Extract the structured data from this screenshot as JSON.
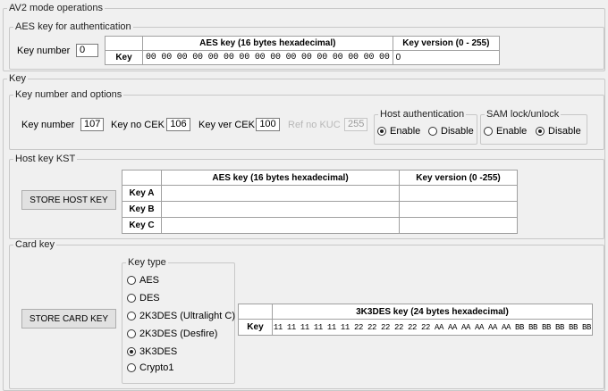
{
  "auth": {
    "group_title": "AV2 mode operations",
    "section_title": "AES key for authentication",
    "key_number_label": "Key number",
    "key_number_value": "0",
    "col_key": "AES key (16 bytes hexadecimal)",
    "col_version": "Key version (0 - 255)",
    "row_label": "Key",
    "key_value": "00 00 00 00 00 00 00 00 00 00 00 00 00 00 00 00",
    "version_value": "0"
  },
  "key": {
    "group_title": "Key",
    "options": {
      "title": "Key number and options",
      "key_number_label": "Key number",
      "key_number_value": "107",
      "key_no_cek_label": "Key no CEK",
      "key_no_cek_value": "106",
      "key_ver_cek_label": "Key ver CEK",
      "key_ver_cek_value": "100",
      "ref_no_kuc_label": "Ref no KUC",
      "ref_no_kuc_value": "255",
      "host_auth": {
        "title": "Host authentication",
        "enable_label": "Enable",
        "disable_label": "Disable",
        "selected": "Enable"
      },
      "sam_lock": {
        "title": "SAM lock/unlock",
        "enable_label": "Enable",
        "disable_label": "Disable",
        "selected": "Disable"
      }
    },
    "host_kst": {
      "title": "Host key KST",
      "store_button": "STORE HOST KEY",
      "col_key": "AES key (16 bytes hexadecimal)",
      "col_version": "Key version (0 -255)",
      "rows": [
        {
          "label": "Key A",
          "key": "",
          "version": ""
        },
        {
          "label": "Key B",
          "key": "",
          "version": ""
        },
        {
          "label": "Key C",
          "key": "",
          "version": ""
        }
      ]
    },
    "card_key": {
      "title": "Card key",
      "store_button": "STORE CARD KEY",
      "key_type": {
        "title": "Key type",
        "options": [
          "AES",
          "DES",
          "2K3DES (Ultralight C)",
          "2K3DES (Desfire)",
          "3K3DES",
          "Crypto1"
        ],
        "selected": "3K3DES"
      },
      "col_key": "3K3DES key (24 bytes hexadecimal)",
      "row_label": "Key",
      "key_value": "11 11 11 11 11 11 22 22 22 22 22 22 AA AA AA AA AA AA BB BB BB BB BB BB"
    }
  }
}
